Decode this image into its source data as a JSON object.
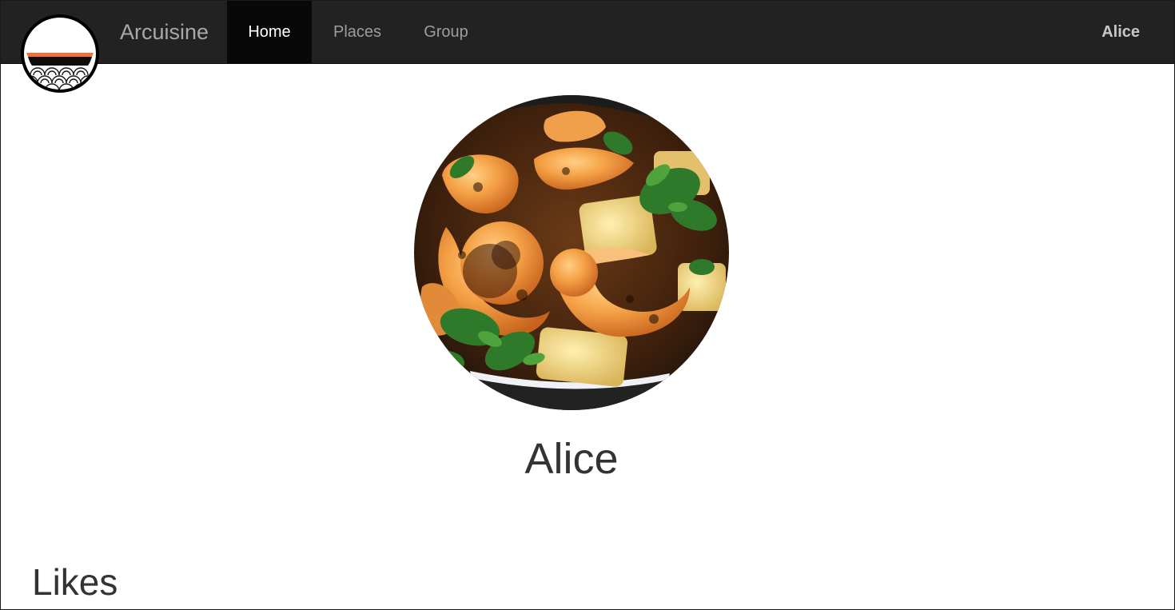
{
  "navbar": {
    "brand": "Arcuisine",
    "logo_icon": "bowl-waves-logo-icon",
    "items": [
      {
        "label": "Home",
        "active": true
      },
      {
        "label": "Places",
        "active": false
      },
      {
        "label": "Group",
        "active": false
      }
    ],
    "user": "Alice",
    "background_color": "#222222",
    "active_color": "#080808"
  },
  "profile": {
    "name": "Alice",
    "photo_description": "shrimp-potato-herb-dish-photo"
  },
  "likes": {
    "heading": "Likes"
  }
}
